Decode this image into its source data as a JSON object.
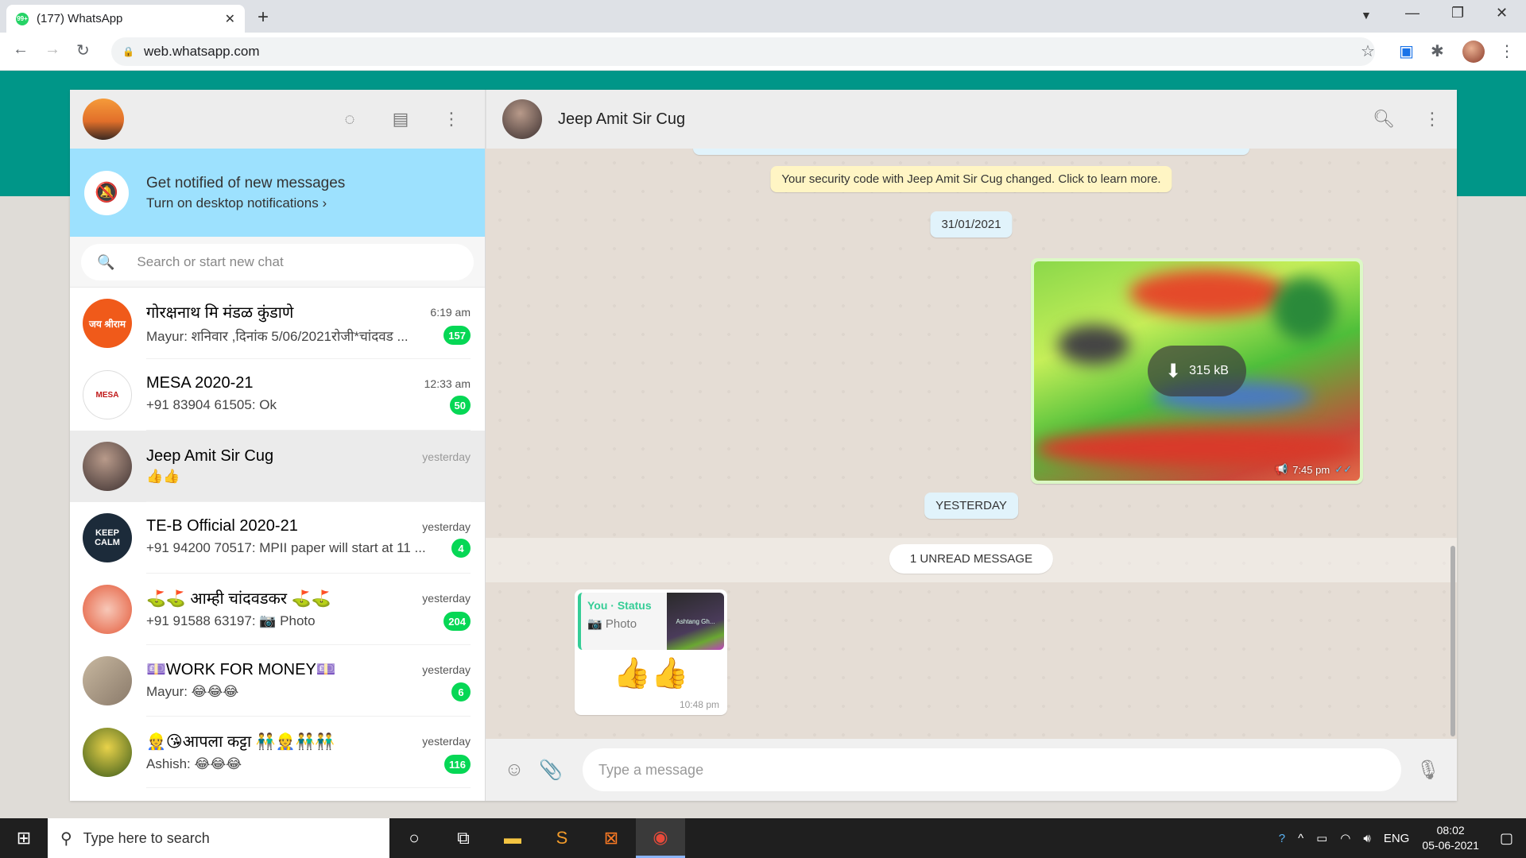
{
  "browser": {
    "tab_title": "(177) WhatsApp",
    "favicon_badge": "99+",
    "url": "web.whatsapp.com"
  },
  "left_header": {
    "icons": [
      "status-icon",
      "new-chat-icon",
      "menu-icon"
    ]
  },
  "notification": {
    "title": "Get notified of new messages",
    "subtitle": "Turn on desktop notifications ›"
  },
  "search": {
    "placeholder": "Search or start new chat"
  },
  "chats": [
    {
      "name": "गोरक्षनाथ मि मंडळ कुंडाणे",
      "time": "6:19 am",
      "preview": "Mayur: शनिवार ,दिनांक 5/06/2021रोजी*चांदवड ...",
      "badge": "157",
      "avatar_text": "जय श्रीराम",
      "avatar_color": "#f05a1a"
    },
    {
      "name": "MESA 2020-21",
      "time": "12:33 am",
      "preview": "+91 83904 61505: Ok",
      "badge": "50",
      "avatar_text": "MESA",
      "avatar_color": "#ffffff"
    },
    {
      "name": "Jeep Amit Sir Cug",
      "time": "yesterday",
      "preview": "👍👍",
      "badge": "",
      "avatar_text": "",
      "avatar_color": "#6b5a55"
    },
    {
      "name": "TE-B Official 2020-21",
      "time": "yesterday",
      "preview": "+91 94200 70517: MPII paper will start at 11 ...",
      "badge": "4",
      "avatar_text": "KEEP CALM",
      "avatar_color": "#1c2b3a"
    },
    {
      "name": "⛳⛳ आम्ही चांदवडकर ⛳⛳",
      "time": "yesterday",
      "preview": "+91 91588 63197: 📷 Photo",
      "badge": "204",
      "avatar_text": "",
      "avatar_color": "#e45a3a"
    },
    {
      "name": "💷WORK FOR MONEY💷",
      "time": "yesterday",
      "preview": "Mayur: 😂😂😂",
      "badge": "6",
      "avatar_text": "",
      "avatar_color": "#b3a08a"
    },
    {
      "name": "👷😘आपला कट्टा 👬👷👬👬",
      "time": "yesterday",
      "preview": "Ashish: 😂😂😂",
      "badge": "116",
      "avatar_text": "",
      "avatar_color": "#6b8a2a"
    }
  ],
  "conversation": {
    "name": "Jeep Amit Sir Cug",
    "security_notice": "Your security code with Jeep Amit Sir Cug changed. Click to learn more.",
    "date_chip_1": "31/01/2021",
    "image_message": {
      "size": "315 kB",
      "time": "7:45 pm"
    },
    "date_chip_2": "YESTERDAY",
    "unread_label": "1 UNREAD MESSAGE",
    "reply": {
      "quoted_author": "You · Status",
      "quoted_type": "📷 Photo",
      "thumb_text": "Ashtang Gh...",
      "body": "👍👍",
      "time": "10:48 pm"
    },
    "compose_placeholder": "Type a message"
  },
  "taskbar": {
    "search_placeholder": "Type here to search",
    "language": "ENG",
    "time": "08:02",
    "date": "05-06-2021"
  },
  "colors": {
    "accent_teal": "#009688",
    "badge_green": "#06d755",
    "notify_blue": "#9de1fe",
    "outgoing_bubble": "#dcf8c6"
  }
}
